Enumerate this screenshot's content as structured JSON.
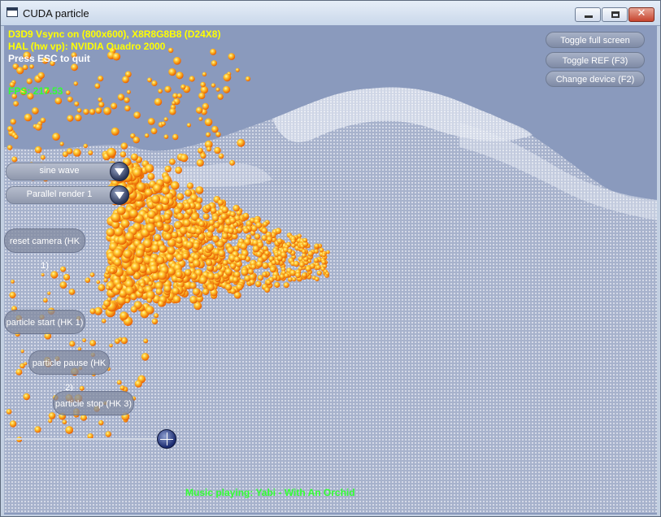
{
  "window": {
    "title": "CUDA particle",
    "app_icon": "window-app-icon",
    "controls": {
      "minimize": "minimize-icon",
      "maximize": "maximize-icon",
      "close": "close-icon",
      "close_glyph": "✕"
    }
  },
  "hud": {
    "line1": "D3D9 Vsync on (800x600), X8R8G8B8 (D24X8)",
    "line2": "HAL (hw vp): NVIDIA Quadro 2000",
    "line3": "Press ESC to quit",
    "fps": "FPS: 217.53"
  },
  "right_buttons": {
    "fullscreen": "Toggle full screen",
    "ref": "Toggle REF (F3)",
    "device": "Change device (F2)"
  },
  "left_controls": {
    "wave_combo": "sine wave",
    "render_combo": "Parallel render 1",
    "reset_camera": "reset camera (HK 1)",
    "particle_start": "particle start (HK 1)",
    "particle_pause": "particle pause (HK 2)",
    "particle_stop": "particle stop (HK 3)"
  },
  "music": "Music playing: Yabi - With An Orchid",
  "colors": {
    "background": "#8a9abd",
    "mesh": "#ffffff",
    "particle_core": "#ffcc33",
    "particle_edge": "#ff6a00",
    "hud_yellow": "#ffff00",
    "hud_green": "#33ff33"
  }
}
